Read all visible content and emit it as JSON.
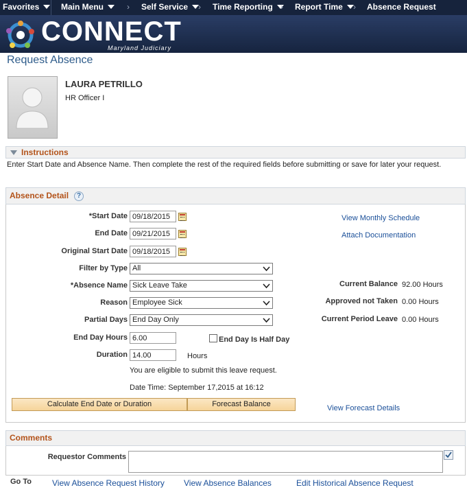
{
  "nav": {
    "items": [
      "Favorites",
      "Main Menu",
      "Self Service",
      "Time Reporting",
      "Report Time",
      "Absence Request"
    ]
  },
  "banner": {
    "brand": "CONNECT",
    "sub": "Maryland Judiciary"
  },
  "page": {
    "title": "Request Absence"
  },
  "person": {
    "name": "LAURA PETRILLO",
    "title": "HR Officer I"
  },
  "instructions": {
    "heading": "Instructions",
    "text": "Enter Start Date and Absence Name. Then complete the rest of the required fields before submitting or save for later your request."
  },
  "absence_detail": {
    "heading": "Absence Detail",
    "help_icon": "?",
    "start_date_label": "*Start Date",
    "start_date": "09/18/2015",
    "end_date_label": "End Date",
    "end_date": "09/21/2015",
    "original_start_label": "Original Start Date",
    "original_start": "09/18/2015",
    "filter_label": "Filter by Type",
    "filter_value": "All",
    "absence_name_label": "*Absence Name",
    "absence_name_value": "Sick Leave Take",
    "reason_label": "Reason",
    "reason_value": "Employee Sick",
    "partial_days_label": "Partial Days",
    "partial_days_value": "End Day Only",
    "end_day_hours_label": "End Day Hours",
    "end_day_hours": "6.00",
    "half_day_label": "End Day Is Half Day",
    "duration_label": "Duration",
    "duration": "14.00",
    "duration_unit": "Hours",
    "eligible_text": "You are eligible to submit this leave request.",
    "datetime_text": "Date Time: September 17,2015 at 16:12",
    "calc_button": "Calculate End Date or Duration",
    "forecast_button": "Forecast Balance",
    "view_schedule_link": "View Monthly Schedule",
    "attach_link": "Attach Documentation",
    "forecast_details_link": "View Forecast Details",
    "current_balance_label": "Current Balance",
    "current_balance": "92.00 Hours",
    "approved_label": "Approved not Taken",
    "approved_value": "0.00 Hours",
    "current_period_label": "Current Period Leave",
    "current_period_value": "0.00 Hours"
  },
  "comments": {
    "heading": "Comments",
    "requestor_label": "Requestor Comments",
    "requestor_value": ""
  },
  "footer": {
    "goto_label": "Go To",
    "links": [
      "View Absence Request History",
      "View Absence Balances",
      "Edit Historical Absence Request"
    ]
  },
  "colors": {
    "nav_bg": "#16233c",
    "title_blue": "#2d5b8a",
    "section_orange": "#b3531a",
    "link_blue": "#1a4f99",
    "button_bg": "#f6d49a"
  }
}
